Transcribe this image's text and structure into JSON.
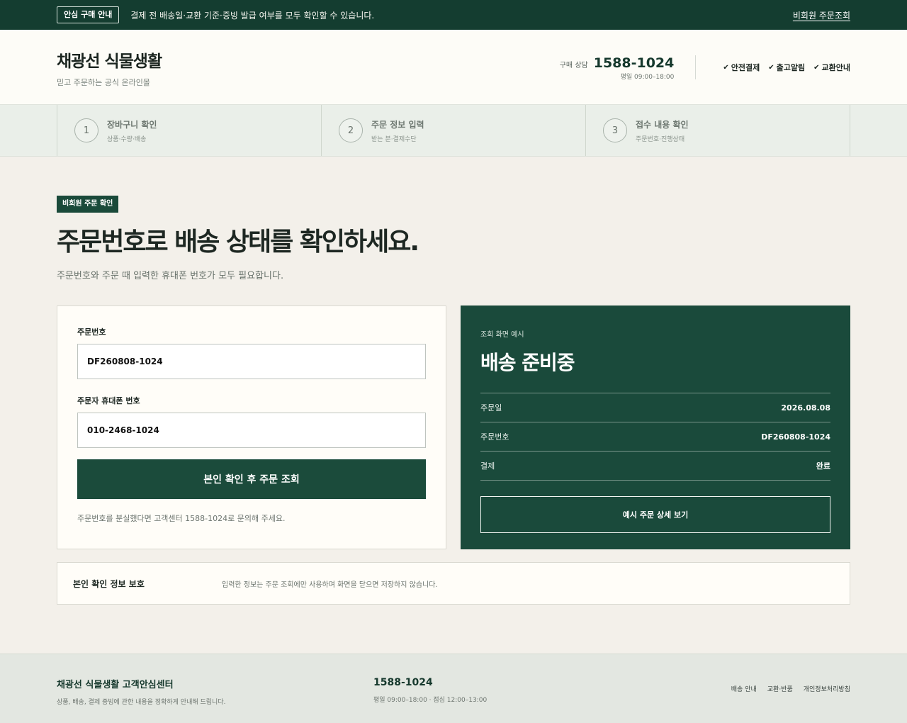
{
  "topbar": {
    "badge": "안심 구매 안내",
    "notice": "결제 전 배송일·교환 기준·증빙 발급 여부를 모두 확인할 수 있습니다.",
    "link": "비회원 주문조회"
  },
  "header": {
    "brand_name": "채광선 식물생활",
    "brand_tagline": "믿고 주문하는 공식 온라인몰",
    "hotline_label": "구매 상담",
    "hotline_number": "1588-1024",
    "hotline_hours": "평일 09:00–18:00",
    "badges": [
      "안전결제",
      "출고알림",
      "교환안내"
    ]
  },
  "steps": [
    {
      "num": "1",
      "title": "장바구니 확인",
      "sub": "상품·수량·배송"
    },
    {
      "num": "2",
      "title": "주문 정보 입력",
      "sub": "받는 분·결제수단"
    },
    {
      "num": "3",
      "title": "접수 내용 확인",
      "sub": "주문번호·진행상태"
    }
  ],
  "main": {
    "kicker": "비회원 주문 확인",
    "headline": "주문번호로 배송 상태를 확인하세요.",
    "subline": "주문번호와 주문 때 입력한 휴대폰 번호가 모두 필요합니다."
  },
  "form": {
    "order_label": "주문번호",
    "order_value": "DF260808-1024",
    "phone_label": "주문자 휴대폰 번호",
    "phone_value": "010-2468-1024",
    "submit_label": "본인 확인 후 주문 조회",
    "help_text": "주문번호를 분실했다면 고객센터 1588-1024로 문의해 주세요."
  },
  "preview": {
    "label": "조회 화면 예시",
    "status": "배송 준비중",
    "rows": [
      {
        "key": "주문일",
        "value": "2026.08.08"
      },
      {
        "key": "주문번호",
        "value": "DF260808-1024"
      },
      {
        "key": "결제",
        "value": "완료"
      }
    ],
    "detail_button": "예시 주문 상세 보기"
  },
  "privacy": {
    "title": "본인 확인 정보 보호",
    "text": "입력한 정보는 주문 조회에만 사용하며 화면을 닫으면 저장하지 않습니다."
  },
  "footer": {
    "title": "채광선 식물생활 고객안심센터",
    "desc": "상품, 배송, 결제 증빙에 관한 내용을 정확하게 안내해 드립니다.",
    "phone": "1588-1024",
    "hours": "평일 09:00–18:00 · 점심 12:00–13:00",
    "links": [
      "배송 안내",
      "교환·반품",
      "개인정보처리방침"
    ]
  },
  "colors": {
    "primary": "#1a4a3b",
    "topbar": "#143d30",
    "background": "#f3f0ea"
  }
}
